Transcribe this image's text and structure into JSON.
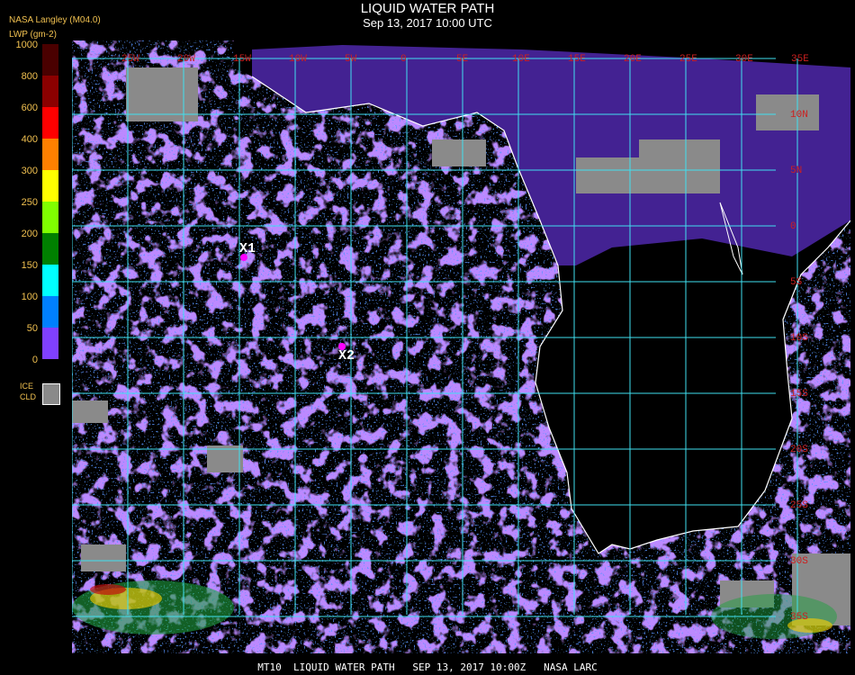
{
  "title": "LIQUID WATER PATH",
  "subtitle": "Sep 13, 2017 10:00 UTC",
  "producer": "NASA Langley (M04.0)",
  "units": "LWP (gm-2)",
  "legend": {
    "levels": [
      "1000",
      "800",
      "600",
      "400",
      "300",
      "250",
      "200",
      "150",
      "100",
      "50",
      "0"
    ],
    "colors": [
      "#4a0000",
      "#8b0000",
      "#ff0000",
      "#ff8000",
      "#ffff00",
      "#80ff00",
      "#008000",
      "#00ffff",
      "#0080ff",
      "#0000ff",
      "#8040ff"
    ],
    "ice_label_1": "ICE",
    "ice_label_2": "CLD",
    "ice_color": "#8a8a8a"
  },
  "grid": {
    "lon_labels": [
      "25W",
      "20W",
      "15W",
      "10W",
      "5W",
      "0",
      "5E",
      "10E",
      "15E",
      "20E",
      "25E",
      "30E",
      "35E"
    ],
    "lat_labels": [
      "10N",
      "5N",
      "0",
      "5S",
      "10S",
      "15S",
      "20S",
      "25S",
      "30S",
      "35S",
      "40S"
    ],
    "grid_color": "#40e0f0",
    "label_color": "#cc2020"
  },
  "markers": [
    {
      "label": "X1",
      "color": "#ff00ff"
    },
    {
      "label": "X2",
      "color": "#ff00ff"
    }
  ],
  "footer": "MT10  LIQUID WATER PATH   SEP 13, 2017 10:00Z   NASA LARC"
}
